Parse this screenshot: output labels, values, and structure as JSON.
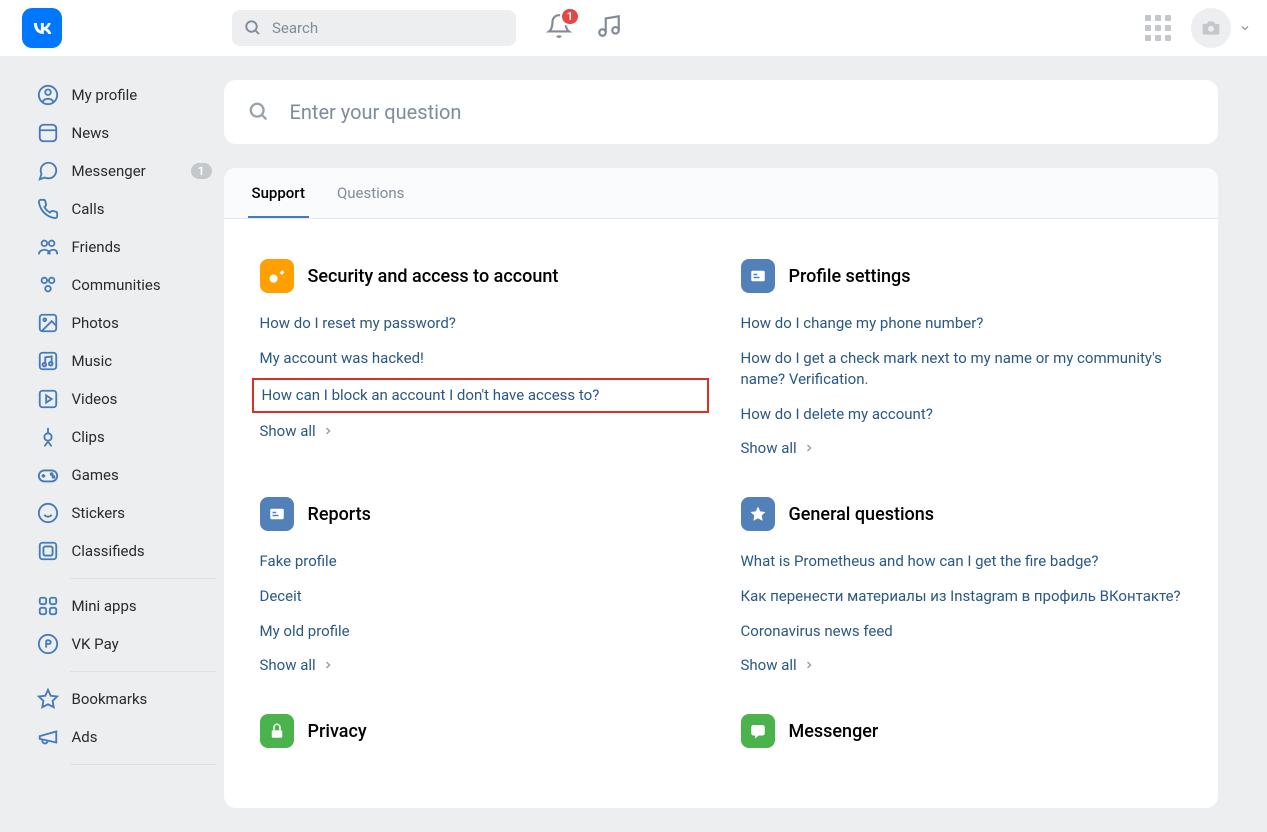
{
  "header": {
    "search_placeholder": "Search",
    "notif_count": "1"
  },
  "sidebar": {
    "items": [
      {
        "label": "My profile"
      },
      {
        "label": "News"
      },
      {
        "label": "Messenger",
        "badge": "1"
      },
      {
        "label": "Calls"
      },
      {
        "label": "Friends"
      },
      {
        "label": "Communities"
      },
      {
        "label": "Photos"
      },
      {
        "label": "Music"
      },
      {
        "label": "Videos"
      },
      {
        "label": "Clips"
      },
      {
        "label": "Games"
      },
      {
        "label": "Stickers"
      },
      {
        "label": "Classifieds"
      }
    ],
    "items2": [
      {
        "label": "Mini apps"
      },
      {
        "label": "VK Pay"
      }
    ],
    "items3": [
      {
        "label": "Bookmarks"
      },
      {
        "label": "Ads"
      }
    ]
  },
  "main": {
    "search_placeholder": "Enter your question",
    "tabs": [
      {
        "label": "Support",
        "active": true
      },
      {
        "label": "Questions",
        "active": false
      }
    ],
    "show_all_label": "Show all",
    "sections": {
      "security": {
        "title": "Security and access to account",
        "links": [
          "How do I reset my password?",
          "My account was hacked!",
          "How can I block an account I don't have access to?"
        ]
      },
      "profile": {
        "title": "Profile settings",
        "links": [
          "How do I change my phone number?",
          "How do I get a check mark next to my name or my community's name? Verification.",
          "How do I delete my account?"
        ]
      },
      "reports": {
        "title": "Reports",
        "links": [
          "Fake profile",
          "Deceit",
          "My old profile"
        ]
      },
      "general": {
        "title": "General questions",
        "links": [
          "What is Prometheus and how can I get the fire badge?",
          "Как перенести материалы из Instagram в профиль ВКонтакте?",
          "Coronavirus news feed"
        ]
      },
      "privacy": {
        "title": "Privacy"
      },
      "messenger": {
        "title": "Messenger"
      }
    }
  }
}
